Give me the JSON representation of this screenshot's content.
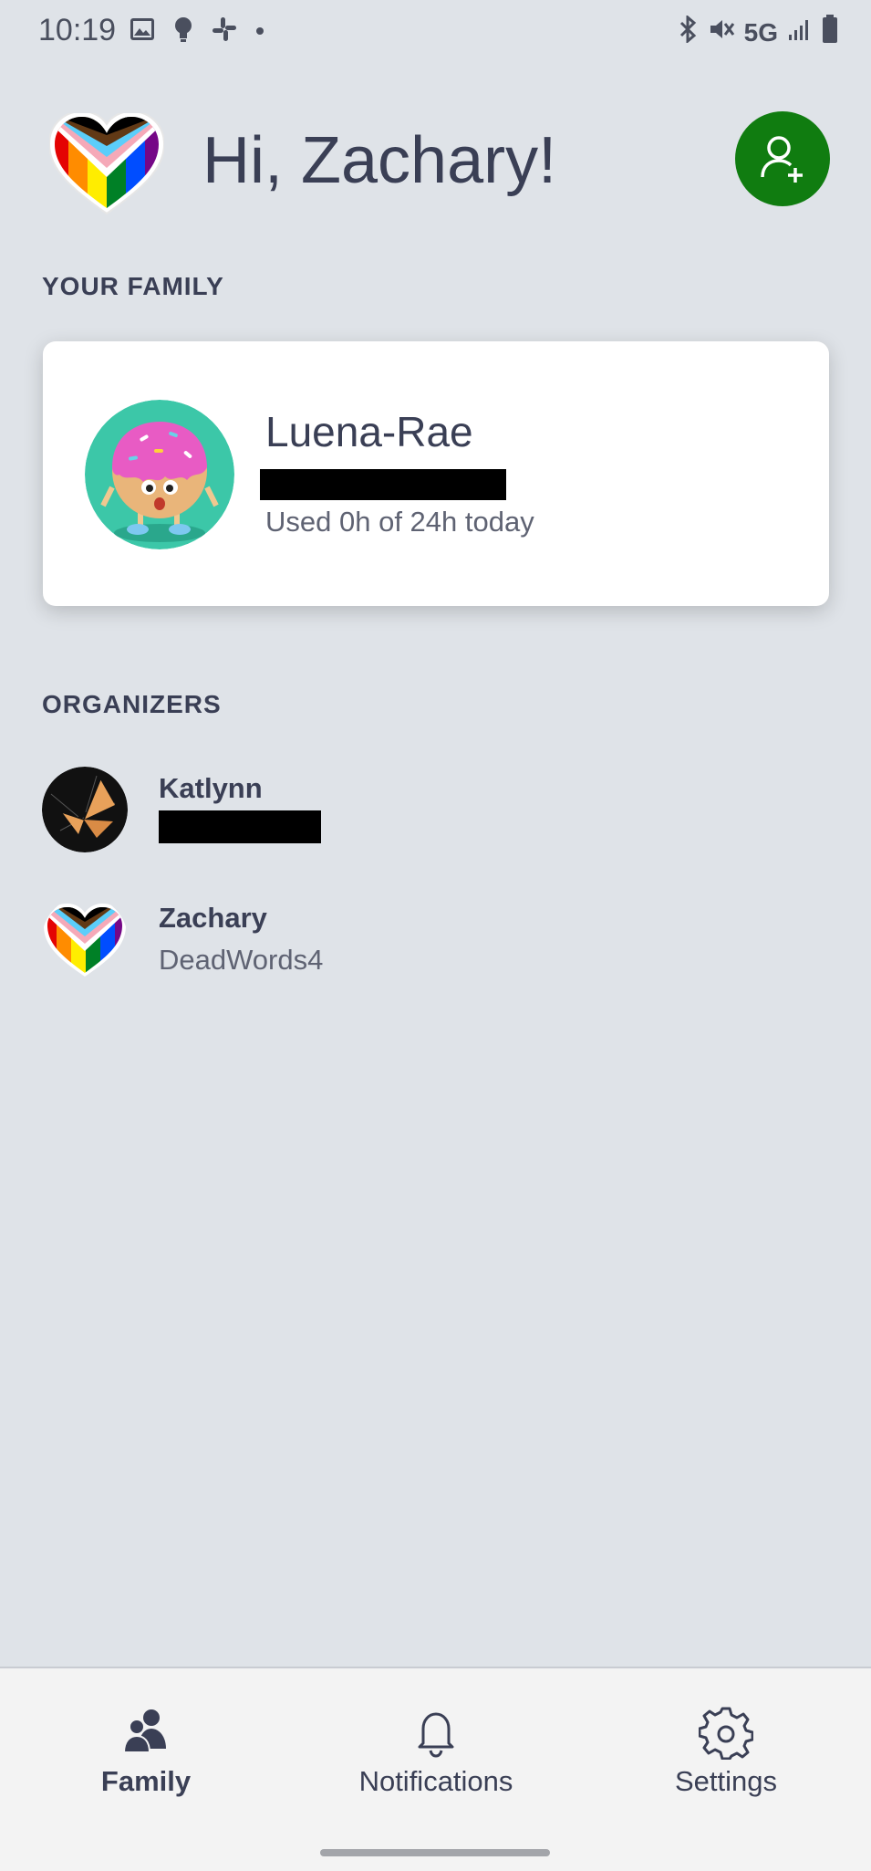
{
  "status_bar": {
    "time": "10:19",
    "network": "5G",
    "left_icons": [
      "gallery-icon",
      "lightbulb-icon",
      "slack-icon",
      "dot-icon"
    ],
    "right_icons": [
      "bluetooth-icon",
      "mute-icon",
      "signal-icon",
      "battery-icon"
    ]
  },
  "header": {
    "greeting": "Hi, Zachary!",
    "add_member_icon": "add-person-icon",
    "accent_color": "#107c10"
  },
  "family": {
    "section_label": "YOUR FAMILY",
    "members": [
      {
        "name": "Luena-Rae",
        "usage": "Used 0h of 24h today",
        "avatar": "donut-avatar"
      }
    ]
  },
  "organizers": {
    "section_label": "ORGANIZERS",
    "items": [
      {
        "name": "Katlynn",
        "subtitle": "",
        "avatar": "butterfly-avatar"
      },
      {
        "name": "Zachary",
        "subtitle": "DeadWords4",
        "avatar": "pride-heart-avatar"
      }
    ]
  },
  "bottom_nav": {
    "items": [
      {
        "label": "Family",
        "icon": "family-icon",
        "active": true
      },
      {
        "label": "Notifications",
        "icon": "bell-icon",
        "active": false
      },
      {
        "label": "Settings",
        "icon": "gear-icon",
        "active": false
      }
    ]
  }
}
